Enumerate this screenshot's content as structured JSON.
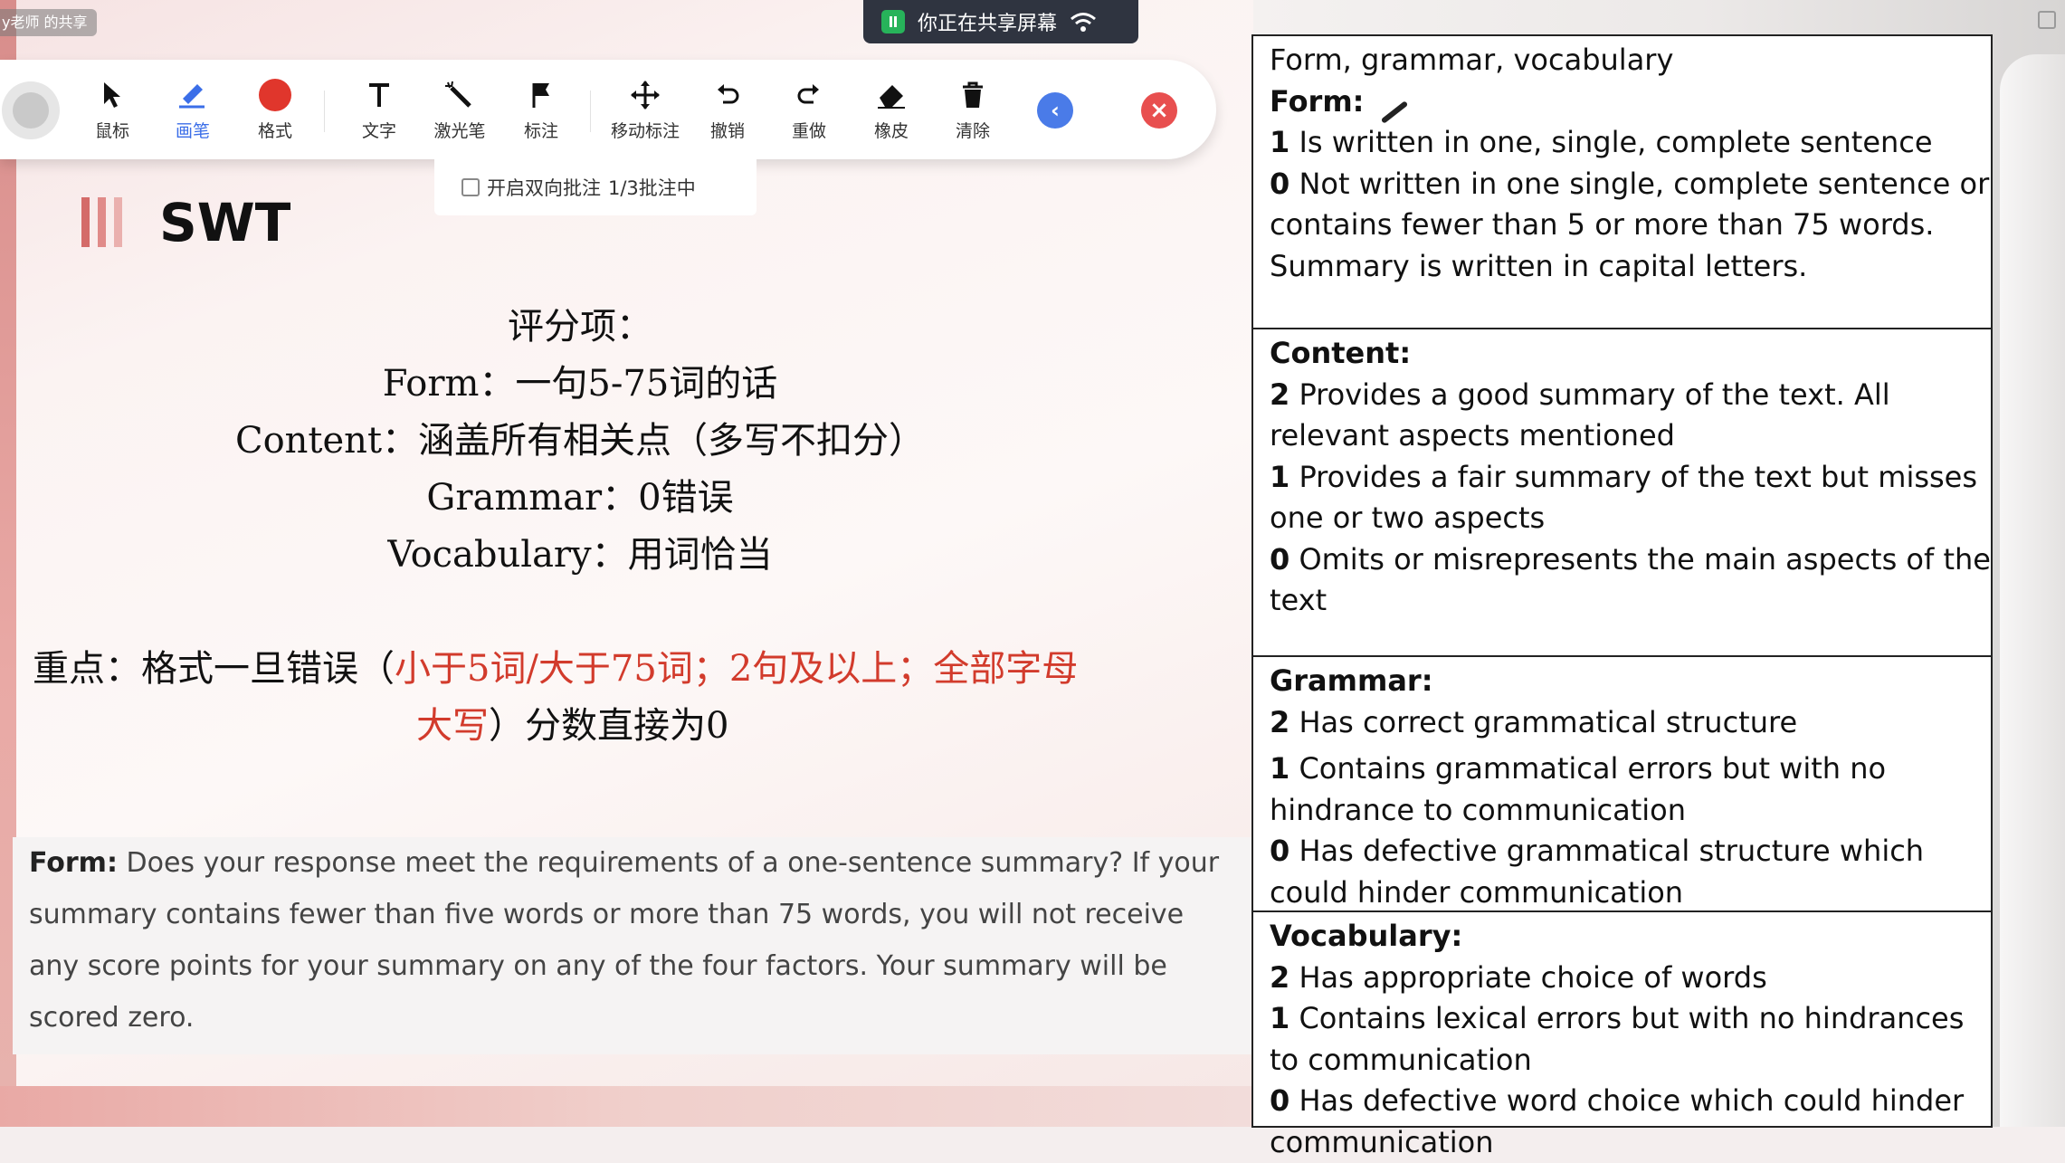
{
  "share_label": "y老师 的共享",
  "sharing_banner": {
    "text": "你正在共享屏幕"
  },
  "toolbar": {
    "tools": [
      {
        "label": "鼠标",
        "icon": "cursor-icon"
      },
      {
        "label": "画笔",
        "icon": "pen-icon",
        "active": true
      },
      {
        "label": "格式",
        "icon": "color-dot-icon"
      },
      {
        "label": "文字",
        "icon": "text-icon"
      },
      {
        "label": "激光笔",
        "icon": "laser-pointer-icon"
      },
      {
        "label": "标注",
        "icon": "flag-icon"
      },
      {
        "label": "移动标注",
        "icon": "move-icon"
      },
      {
        "label": "撤销",
        "icon": "undo-icon"
      },
      {
        "label": "重做",
        "icon": "redo-icon"
      },
      {
        "label": "橡皮",
        "icon": "eraser-icon"
      },
      {
        "label": "清除",
        "icon": "trash-icon"
      }
    ],
    "collapse_icon": "chevron-left-icon",
    "close_icon": "close-icon",
    "accent": "#3b6ee8",
    "format_color": "#e0362c"
  },
  "sub_bar": {
    "checkbox_label": "开启双向批注",
    "status": "1/3批注中"
  },
  "slide": {
    "title": "SWT",
    "criteria": [
      "评分项：",
      "Form：一句5-75词的话",
      "Content：涵盖所有相关点（多写不扣分）",
      "Grammar：0错误",
      "Vocabulary：用词恰当"
    ],
    "focus": {
      "prefix": "重点：格式一旦错误（",
      "red_line1": "小于5词/大于75词；2句及以上；全部字母",
      "red_line2": "大写",
      "suffix": "）分数直接为0"
    },
    "note": {
      "label": "Form:",
      "text": " Does your response meet the requirements of a one-sentence summary? If your summary contains fewer than five words or more than 75 words, you will not receive any score points for your summary on any of the four factors. Your summary will be scored zero."
    }
  },
  "rubric": {
    "heading": "Form, grammar, vocabulary",
    "form": {
      "title": "Form:",
      "items": [
        {
          "score": "1",
          "text": " Is written in one, single, complete sentence"
        },
        {
          "score": "0",
          "text": " Not written in one single, complete sentence or contains fewer than 5 or more than 75 words. Summary is written in capital letters."
        }
      ]
    },
    "content": {
      "title": "Content:",
      "items": [
        {
          "score": "2",
          "text": " Provides a good summary of the text. All relevant aspects mentioned"
        },
        {
          "score": "1",
          "text": " Provides a fair summary of the text but misses one or two aspects"
        },
        {
          "score": "0",
          "text": " Omits or misrepresents the main aspects of the text"
        }
      ]
    },
    "grammar": {
      "title": "Grammar:",
      "items": [
        {
          "score": "2",
          "text": " Has correct grammatical structure"
        },
        {
          "score": "1",
          "text": " Contains grammatical errors but with no hindrance to communication"
        },
        {
          "score": "0",
          "text": " Has defective grammatical structure which could hinder communication"
        }
      ]
    },
    "vocabulary": {
      "title": "Vocabulary:",
      "items": [
        {
          "score": "2",
          "text": " Has appropriate choice of words"
        },
        {
          "score": "1",
          "text": " Contains lexical errors but with no hindrances to communication"
        },
        {
          "score": "0",
          "text": " Has defective word choice which could hinder communication"
        }
      ]
    }
  }
}
